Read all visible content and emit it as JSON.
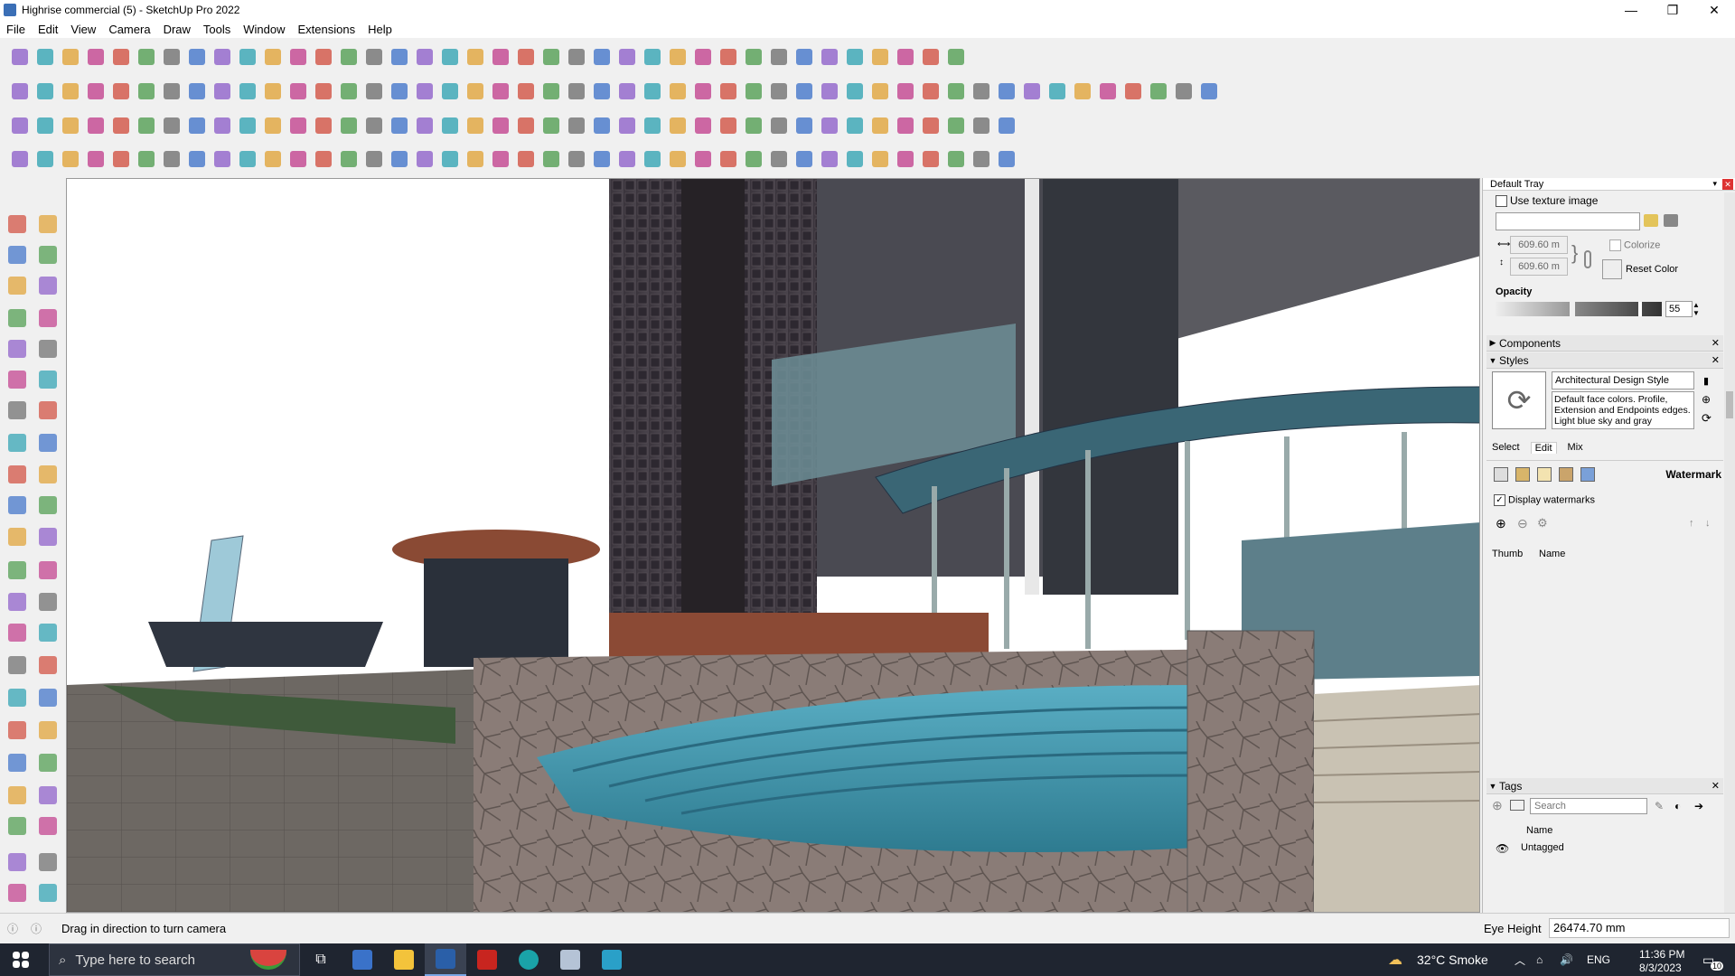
{
  "window": {
    "title": "Highrise commercial (5) - SketchUp Pro 2022",
    "minimize_glyph": "—",
    "maximize_glyph": "❐",
    "close_glyph": "✕"
  },
  "menu": [
    "File",
    "Edit",
    "View",
    "Camera",
    "Draw",
    "Tools",
    "Window",
    "Extensions",
    "Help"
  ],
  "tray": {
    "title": "Default Tray",
    "materials": {
      "use_texture_label": "Use texture image",
      "width_value": "609.60 m",
      "height_value": "609.60 m",
      "colorize_label": "Colorize",
      "reset_color_label": "Reset Color",
      "opacity_label": "Opacity",
      "opacity_value": "55"
    },
    "components_label": "Components",
    "styles": {
      "label": "Styles",
      "style_name": "Architectural Design Style",
      "style_description": "Default face colors. Profile, Extension and Endpoints edges. Light blue sky and gray",
      "tabs": [
        "Select",
        "Edit",
        "Mix"
      ],
      "active_tab": "Edit",
      "section_label": "Watermark",
      "display_watermarks_label": "Display watermarks",
      "col_thumb": "Thumb",
      "col_name": "Name"
    },
    "tags": {
      "label": "Tags",
      "search_placeholder": "Search",
      "col_name": "Name",
      "rows": [
        "Untagged"
      ]
    }
  },
  "status": {
    "hint": "Drag in direction to turn camera",
    "measure_label": "Eye Height",
    "measure_value": "26474.70 mm"
  },
  "taskbar": {
    "search_placeholder": "Type here to search",
    "weather": "32°C  Smoke",
    "language": "ENG",
    "time": "11:36 PM",
    "date": "8/3/2023",
    "notification_count": "10"
  },
  "colors": {
    "sky": "#ffffff",
    "water": "#3c90a8",
    "stone": "#8b7d78",
    "tower": "#3d3840",
    "canopy": "#3a6675"
  }
}
